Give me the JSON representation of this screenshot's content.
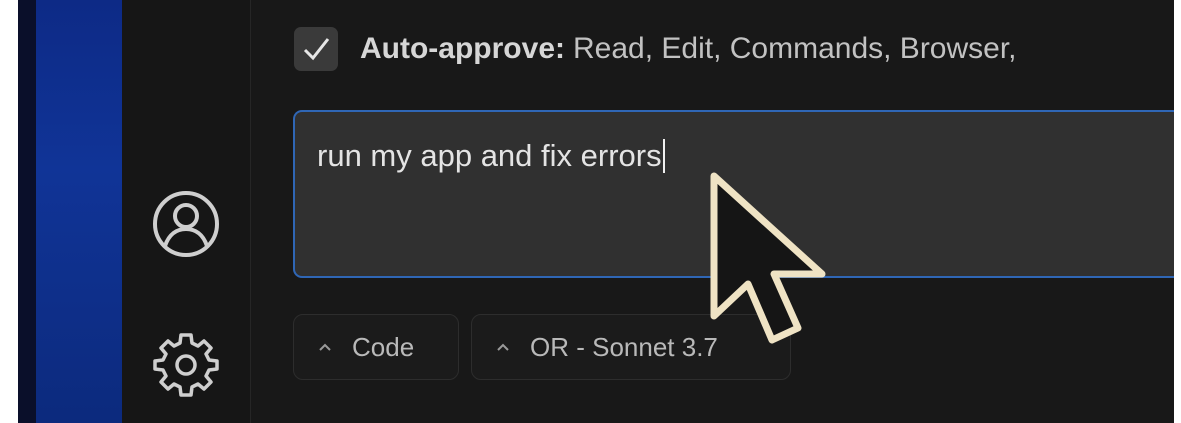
{
  "auto_approve": {
    "checked": true,
    "label": "Auto-approve:",
    "value": "Read, Edit, Commands, Browser,"
  },
  "chat_input": {
    "value": "run my app and fix errors",
    "border_color": "#2f66b5"
  },
  "mode_dropdown": {
    "label": "Code"
  },
  "model_dropdown": {
    "label": "OR - Sonnet 3.7"
  },
  "sidebar": {
    "icons": [
      "account-icon",
      "settings-gear-icon"
    ]
  },
  "colors": {
    "background": "#181818",
    "accent": "#2f66b5",
    "side_strip": "#103497"
  }
}
